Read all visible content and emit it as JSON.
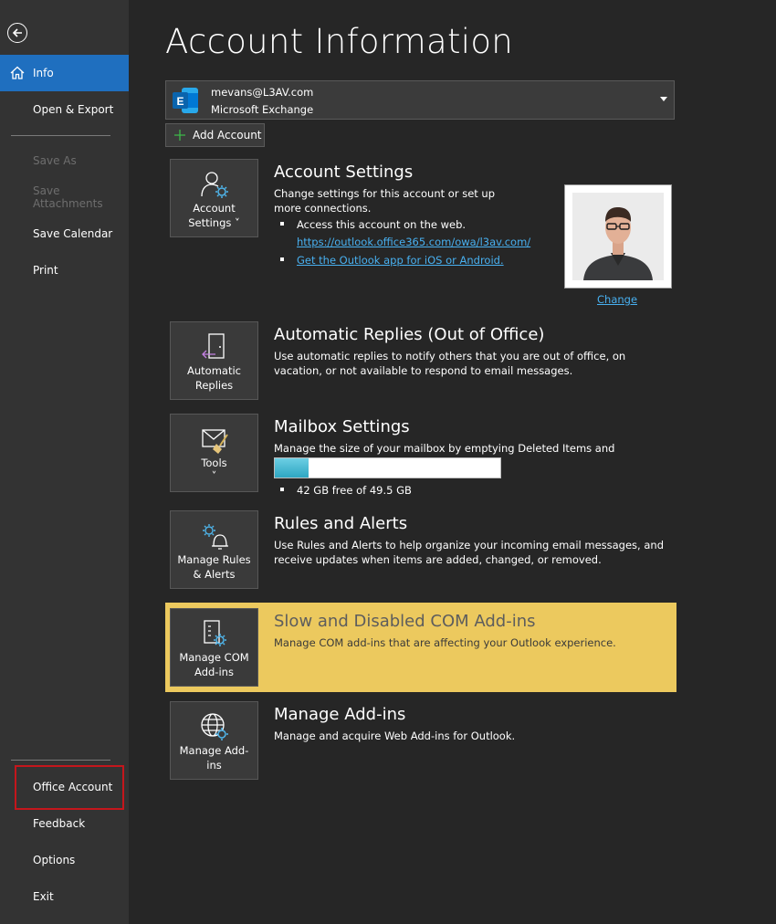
{
  "sidebar": {
    "items": [
      {
        "label": "Info"
      },
      {
        "label": "Open & Export"
      },
      {
        "label": "Save As"
      },
      {
        "label": "Save Attachments"
      },
      {
        "label": "Save Calendar"
      },
      {
        "label": "Print"
      },
      {
        "label": "Office Account"
      },
      {
        "label": "Feedback"
      },
      {
        "label": "Options"
      },
      {
        "label": "Exit"
      }
    ],
    "highlight_color": "#c4161c",
    "active_color": "#1f6fbf"
  },
  "page": {
    "title": "Account Information"
  },
  "account": {
    "email": "mevans@L3AV.com",
    "type": "Microsoft Exchange",
    "add_label": "Add Account"
  },
  "sections": {
    "account_settings": {
      "tile_line1": "Account",
      "tile_line2": "Settings ˅",
      "title": "Account Settings",
      "desc": "Change settings for this account or set up more connections.",
      "bullet1": "Access this account on the web.",
      "web_link": "https://outlook.office365.com/owa/l3av.com/",
      "app_link": "Get the Outlook app for iOS or Android.",
      "change_label": "Change"
    },
    "auto_replies": {
      "tile_line1": "Automatic",
      "tile_line2": "Replies",
      "title": "Automatic Replies (Out of Office)",
      "desc": "Use automatic replies to notify others that you are out of office, on vacation, or not available to respond to email messages."
    },
    "mailbox": {
      "tile_line1": "Tools",
      "tile_line2": "˅",
      "title": "Mailbox Settings",
      "desc": "Manage the size of your mailbox by emptying Deleted Items and archiving.",
      "usage_fraction": 0.15,
      "free_text": "42 GB free of 49.5 GB"
    },
    "rules": {
      "tile_line1": "Manage Rules",
      "tile_line2": "& Alerts",
      "title": "Rules and Alerts",
      "desc": "Use Rules and Alerts to help organize your incoming email messages, and receive updates when items are added, changed, or removed."
    },
    "com_addins": {
      "tile_line1": "Manage COM",
      "tile_line2": "Add-ins",
      "title": "Slow and Disabled COM Add-ins",
      "desc": "Manage COM add-ins that are affecting your Outlook experience.",
      "highlight_color": "#ecc95e"
    },
    "addins": {
      "tile_line1": "Manage Add-",
      "tile_line2": "ins",
      "title": "Manage Add-ins",
      "desc": "Manage and acquire Web Add-ins for Outlook."
    }
  }
}
